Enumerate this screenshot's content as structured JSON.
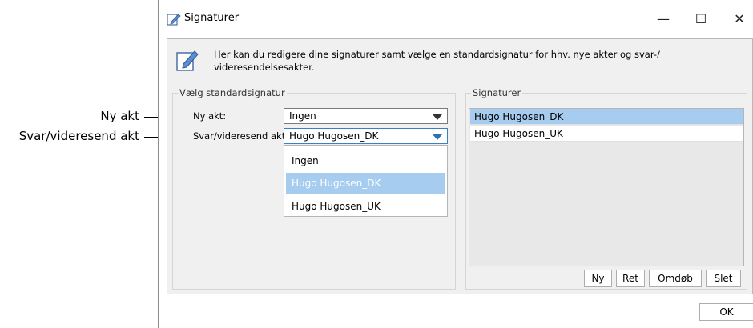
{
  "callouts": {
    "ny_akt": "Ny akt",
    "svar": "Svar/videresend akt"
  },
  "window": {
    "title": "Signaturer",
    "minimize": "—",
    "maximize": "☐",
    "close": "✕"
  },
  "info": {
    "text": "Her kan du redigere dine signaturer samt vælge en standardsignatur for hhv. nye akter og svar-/ videresendelsesakter."
  },
  "standard_group": {
    "legend": "Vælg standardsignatur",
    "ny_akt_label": "Ny akt:",
    "ny_akt_value": "Ingen",
    "svar_label": "Svar/videresend akt:",
    "svar_value": "Hugo Hugosen_DK",
    "dropdown_options": [
      "Ingen",
      "Hugo Hugosen_DK",
      "Hugo Hugosen_UK"
    ],
    "dropdown_selected": "Hugo Hugosen_DK"
  },
  "signatures_group": {
    "legend": "Signaturer",
    "items": [
      "Hugo Hugosen_DK",
      "Hugo Hugosen_UK"
    ],
    "selected": "Hugo Hugosen_DK",
    "buttons": {
      "new": "Ny",
      "edit": "Ret",
      "rename": "Omdøb",
      "delete": "Slet"
    }
  },
  "footer": {
    "ok": "OK"
  }
}
